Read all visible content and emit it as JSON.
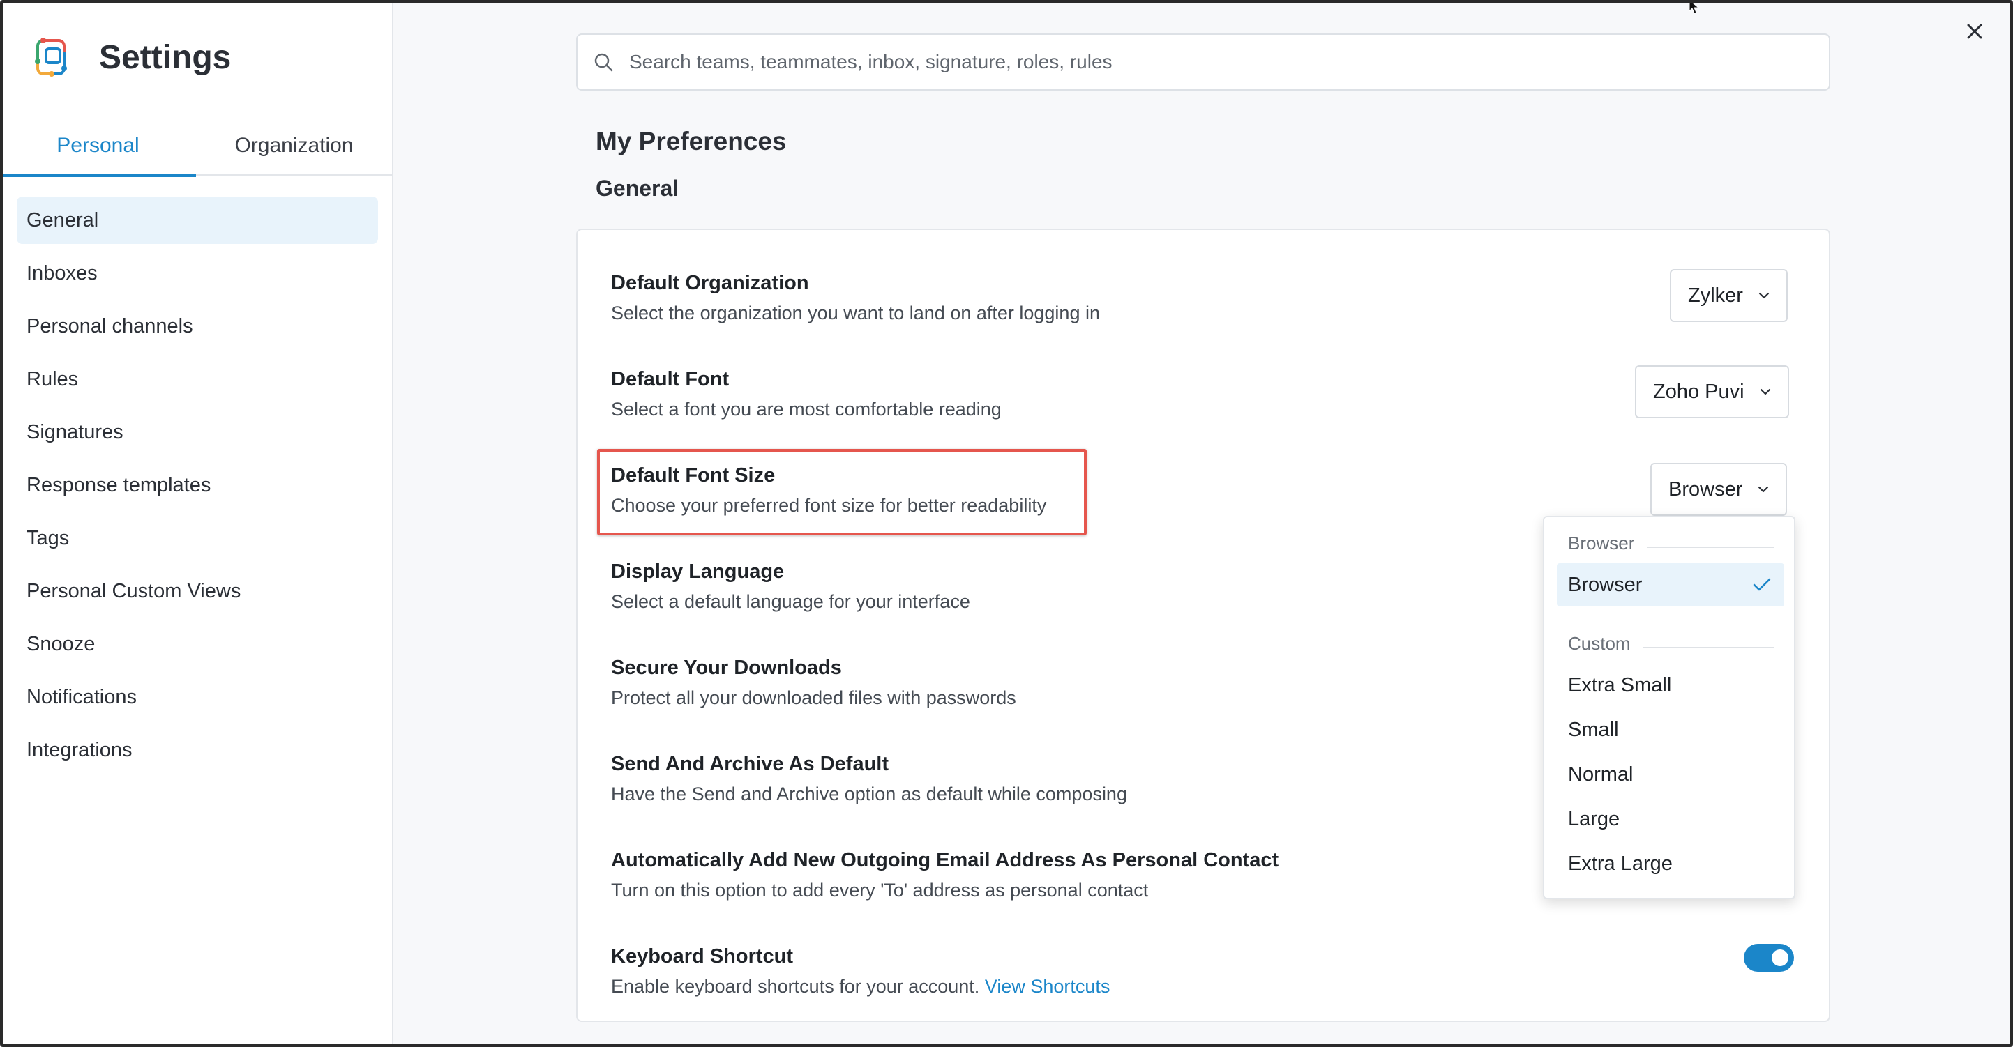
{
  "app": {
    "title": "Settings"
  },
  "tabs": [
    {
      "label": "Personal",
      "active": true
    },
    {
      "label": "Organization",
      "active": false
    }
  ],
  "sidebar": {
    "items": [
      {
        "label": "General",
        "active": true
      },
      {
        "label": "Inboxes"
      },
      {
        "label": "Personal channels"
      },
      {
        "label": "Rules"
      },
      {
        "label": "Signatures"
      },
      {
        "label": "Response templates"
      },
      {
        "label": "Tags"
      },
      {
        "label": "Personal Custom Views"
      },
      {
        "label": "Snooze"
      },
      {
        "label": "Notifications"
      },
      {
        "label": "Integrations"
      }
    ]
  },
  "search": {
    "placeholder": "Search teams, teammates, inbox, signature, roles, rules"
  },
  "page": {
    "title": "My Preferences",
    "section": "General"
  },
  "settings": [
    {
      "label": "Default Organization",
      "desc": "Select the organization you want to land on after logging in",
      "control": "Zylker"
    },
    {
      "label": "Default Font",
      "desc": "Select a font you are most comfortable reading",
      "control": "Zoho Puvi"
    },
    {
      "label": "Default Font Size",
      "desc": "Choose your preferred font size for better readability",
      "control": "Browser"
    },
    {
      "label": "Display Language",
      "desc": "Select a default language for your interface"
    },
    {
      "label": "Secure Your Downloads",
      "desc": "Protect all your downloaded files with passwords"
    },
    {
      "label": "Send And Archive As Default",
      "desc": "Have the Send and Archive option as default while composing"
    },
    {
      "label": "Automatically Add New Outgoing Email Address As Personal Contact",
      "desc": "Turn on this option to add every 'To' address as personal contact"
    },
    {
      "label": "Keyboard Shortcut",
      "desc": "Enable keyboard shortcuts for your account.",
      "link": "View Shortcuts",
      "toggle_on": true
    }
  ],
  "font_size_dropdown": {
    "group_browser": "Browser",
    "browser_option": "Browser",
    "group_custom": "Custom",
    "custom_options": [
      "Extra Small",
      "Small",
      "Normal",
      "Large",
      "Extra Large"
    ],
    "selected": "Browser"
  },
  "colors": {
    "accent": "#1b86c9",
    "highlight": "#e5564d",
    "selected_bg": "#e8f3fb"
  }
}
